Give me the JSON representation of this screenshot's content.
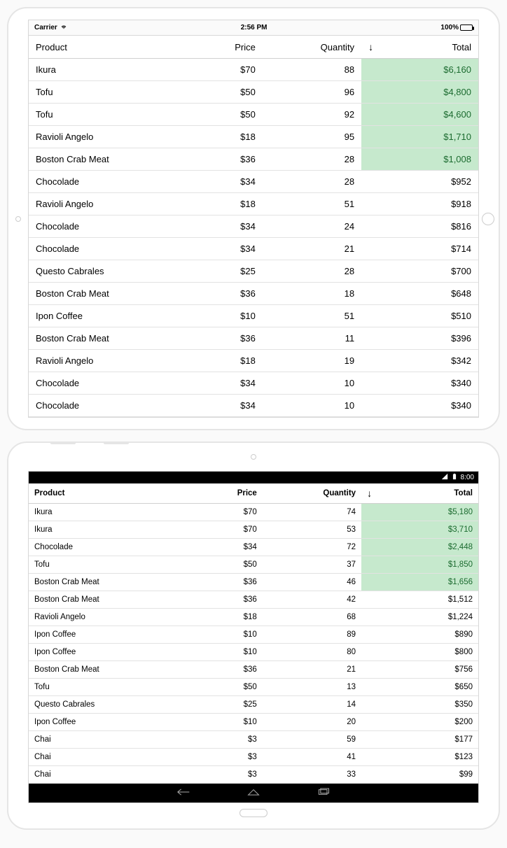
{
  "columns": {
    "product": "Product",
    "price": "Price",
    "quantity": "Quantity",
    "total": "Total",
    "sort_indicator": "↓"
  },
  "ios": {
    "status": {
      "carrier": "Carrier",
      "time": "2:56 PM",
      "battery": "100%"
    },
    "rows": [
      {
        "product": "Ikura",
        "price": "$70",
        "qty": "88",
        "total": "$6,160",
        "hl": true
      },
      {
        "product": "Tofu",
        "price": "$50",
        "qty": "96",
        "total": "$4,800",
        "hl": true
      },
      {
        "product": "Tofu",
        "price": "$50",
        "qty": "92",
        "total": "$4,600",
        "hl": true
      },
      {
        "product": "Ravioli Angelo",
        "price": "$18",
        "qty": "95",
        "total": "$1,710",
        "hl": true
      },
      {
        "product": "Boston Crab Meat",
        "price": "$36",
        "qty": "28",
        "total": "$1,008",
        "hl": true
      },
      {
        "product": "Chocolade",
        "price": "$34",
        "qty": "28",
        "total": "$952",
        "hl": false
      },
      {
        "product": "Ravioli Angelo",
        "price": "$18",
        "qty": "51",
        "total": "$918",
        "hl": false
      },
      {
        "product": "Chocolade",
        "price": "$34",
        "qty": "24",
        "total": "$816",
        "hl": false
      },
      {
        "product": "Chocolade",
        "price": "$34",
        "qty": "21",
        "total": "$714",
        "hl": false
      },
      {
        "product": "Questo Cabrales",
        "price": "$25",
        "qty": "28",
        "total": "$700",
        "hl": false
      },
      {
        "product": "Boston Crab Meat",
        "price": "$36",
        "qty": "18",
        "total": "$648",
        "hl": false
      },
      {
        "product": "Ipon Coffee",
        "price": "$10",
        "qty": "51",
        "total": "$510",
        "hl": false
      },
      {
        "product": "Boston Crab Meat",
        "price": "$36",
        "qty": "11",
        "total": "$396",
        "hl": false
      },
      {
        "product": "Ravioli Angelo",
        "price": "$18",
        "qty": "19",
        "total": "$342",
        "hl": false
      },
      {
        "product": "Chocolade",
        "price": "$34",
        "qty": "10",
        "total": "$340",
        "hl": false
      },
      {
        "product": "Chocolade",
        "price": "$34",
        "qty": "10",
        "total": "$340",
        "hl": false
      }
    ]
  },
  "android": {
    "status": {
      "time": "8:00"
    },
    "rows": [
      {
        "product": "Ikura",
        "price": "$70",
        "qty": "74",
        "total": "$5,180",
        "hl": true
      },
      {
        "product": "Ikura",
        "price": "$70",
        "qty": "53",
        "total": "$3,710",
        "hl": true
      },
      {
        "product": "Chocolade",
        "price": "$34",
        "qty": "72",
        "total": "$2,448",
        "hl": true
      },
      {
        "product": "Tofu",
        "price": "$50",
        "qty": "37",
        "total": "$1,850",
        "hl": true
      },
      {
        "product": "Boston Crab Meat",
        "price": "$36",
        "qty": "46",
        "total": "$1,656",
        "hl": true
      },
      {
        "product": "Boston Crab Meat",
        "price": "$36",
        "qty": "42",
        "total": "$1,512",
        "hl": false
      },
      {
        "product": "Ravioli Angelo",
        "price": "$18",
        "qty": "68",
        "total": "$1,224",
        "hl": false
      },
      {
        "product": "Ipon Coffee",
        "price": "$10",
        "qty": "89",
        "total": "$890",
        "hl": false
      },
      {
        "product": "Ipon Coffee",
        "price": "$10",
        "qty": "80",
        "total": "$800",
        "hl": false
      },
      {
        "product": "Boston Crab Meat",
        "price": "$36",
        "qty": "21",
        "total": "$756",
        "hl": false
      },
      {
        "product": "Tofu",
        "price": "$50",
        "qty": "13",
        "total": "$650",
        "hl": false
      },
      {
        "product": "Questo Cabrales",
        "price": "$25",
        "qty": "14",
        "total": "$350",
        "hl": false
      },
      {
        "product": "Ipon Coffee",
        "price": "$10",
        "qty": "20",
        "total": "$200",
        "hl": false
      },
      {
        "product": "Chai",
        "price": "$3",
        "qty": "59",
        "total": "$177",
        "hl": false
      },
      {
        "product": "Chai",
        "price": "$3",
        "qty": "41",
        "total": "$123",
        "hl": false
      },
      {
        "product": "Chai",
        "price": "$3",
        "qty": "33",
        "total": "$99",
        "hl": false
      }
    ]
  }
}
